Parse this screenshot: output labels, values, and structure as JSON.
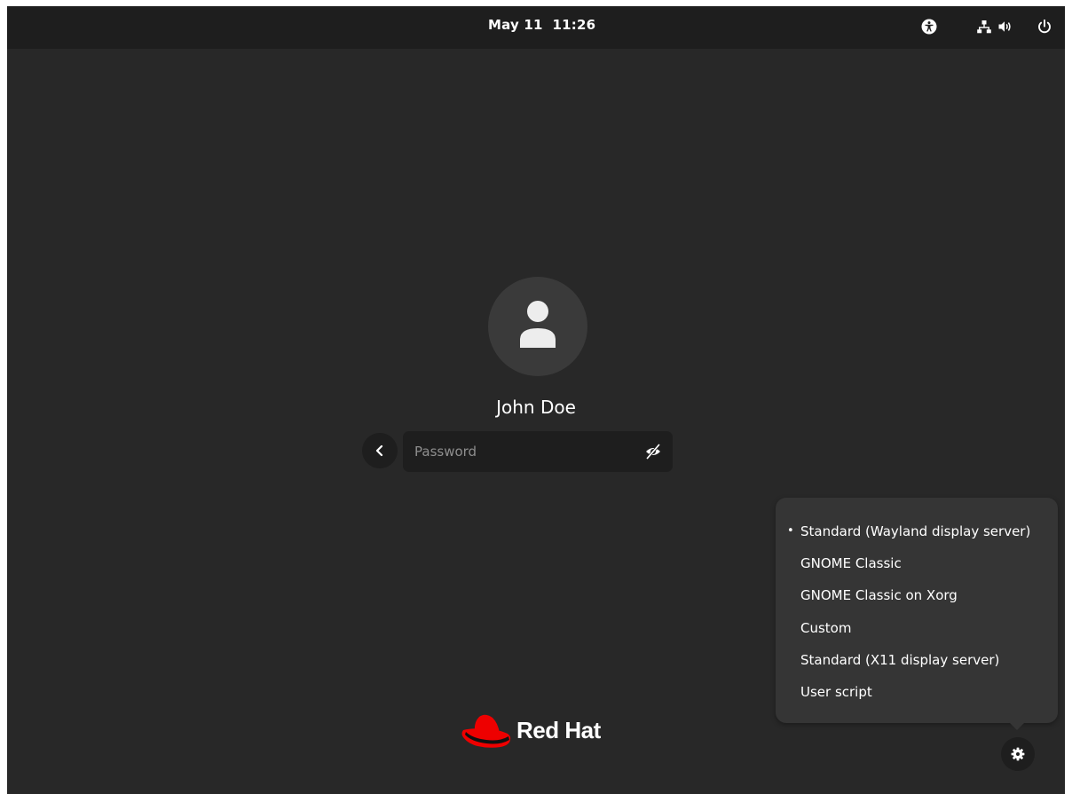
{
  "topbar": {
    "clock": "May 11  11:26",
    "icons": [
      "accessibility-icon",
      "network-wired-icon",
      "volume-icon",
      "power-icon"
    ]
  },
  "login": {
    "username": "John Doe",
    "password_placeholder": "Password",
    "password_value": ""
  },
  "session_menu": {
    "items": [
      {
        "label": "Standard (Wayland display server)",
        "selected": true,
        "bullet": "•"
      },
      {
        "label": "GNOME Classic",
        "selected": false
      },
      {
        "label": "GNOME Classic on Xorg",
        "selected": false
      },
      {
        "label": "Custom",
        "selected": false
      },
      {
        "label": "Standard (X11 display server)",
        "selected": false
      },
      {
        "label": "User script",
        "selected": false
      }
    ]
  },
  "brand": {
    "name": "Red Hat",
    "logo_color": "#ee0000"
  },
  "colors": {
    "background": "#282828",
    "topbar": "#1e1e1e",
    "menu": "#353535",
    "text": "#ffffff",
    "placeholder": "#8e8e8e"
  }
}
